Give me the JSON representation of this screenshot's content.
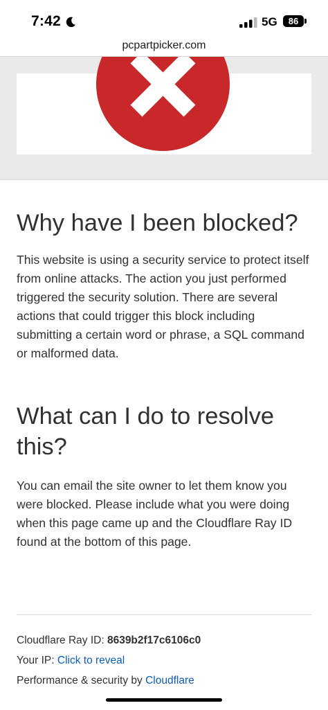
{
  "status_bar": {
    "time": "7:42",
    "network": "5G",
    "battery": "86",
    "icons": [
      "moon-icon",
      "signal-icon",
      "battery-icon"
    ]
  },
  "url_bar": {
    "domain": "pcpartpicker.com"
  },
  "hero": {
    "icon": "error-x-icon",
    "icon_color": "#c8282a"
  },
  "main": {
    "why_heading": "Why have I been blocked?",
    "why_body": "This website is using a security service to protect itself from online attacks. The action you just performed triggered the security solution. There are several actions that could trigger this block including submitting a certain word or phrase, a SQL command or malformed data.",
    "what_heading": "What can I do to resolve this?",
    "what_body": "You can email the site owner to let them know you were blocked. Please include what you were doing when this page came up and the Cloudflare Ray ID found at the bottom of this page."
  },
  "footer": {
    "ray_label": "Cloudflare Ray ID:",
    "ray_id": "8639b2f17c6106c0",
    "ip_label": "Your IP:",
    "ip_link": "Click to reveal",
    "perf_label": "Performance & security by",
    "perf_link": "Cloudflare"
  },
  "colors": {
    "link": "#0f5bb5",
    "text": "#313131",
    "error_red": "#c8282a"
  }
}
